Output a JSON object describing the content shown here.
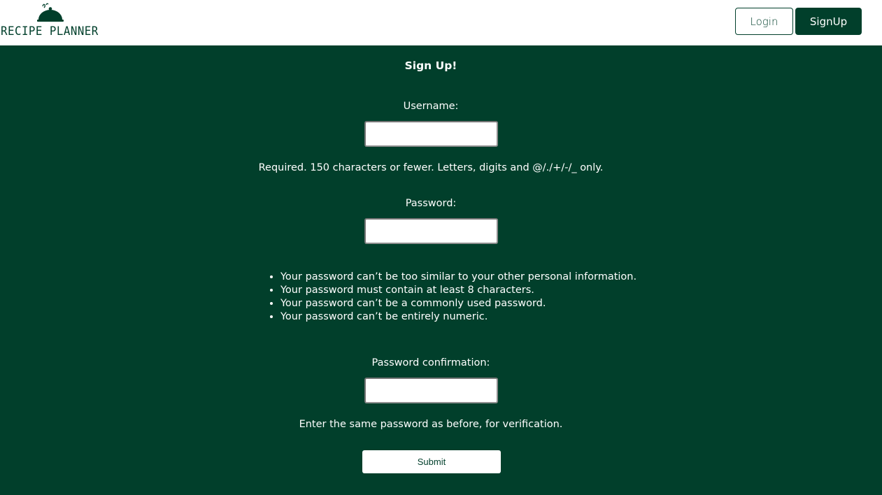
{
  "header": {
    "logo_text": "RECIPE PLANNER",
    "login_label": "Login",
    "signup_label": "SignUp"
  },
  "form": {
    "title": "Sign Up!",
    "username": {
      "label": "Username:",
      "value": "",
      "help": "Required. 150 characters or fewer. Letters, digits and @/./+/-/_ only."
    },
    "password": {
      "label": "Password:",
      "value": "",
      "rules": [
        "Your password can’t be too similar to your other personal information.",
        "Your password must contain at least 8 characters.",
        "Your password can’t be a commonly used password.",
        "Your password can’t be entirely numeric."
      ]
    },
    "password_confirmation": {
      "label": "Password confirmation:",
      "value": "",
      "help": "Enter the same password as before, for verification."
    },
    "submit_label": "Submit"
  },
  "colors": {
    "brand_green": "#013f2b",
    "white": "#ffffff"
  },
  "icons": {
    "logo": "cloche-icon"
  }
}
